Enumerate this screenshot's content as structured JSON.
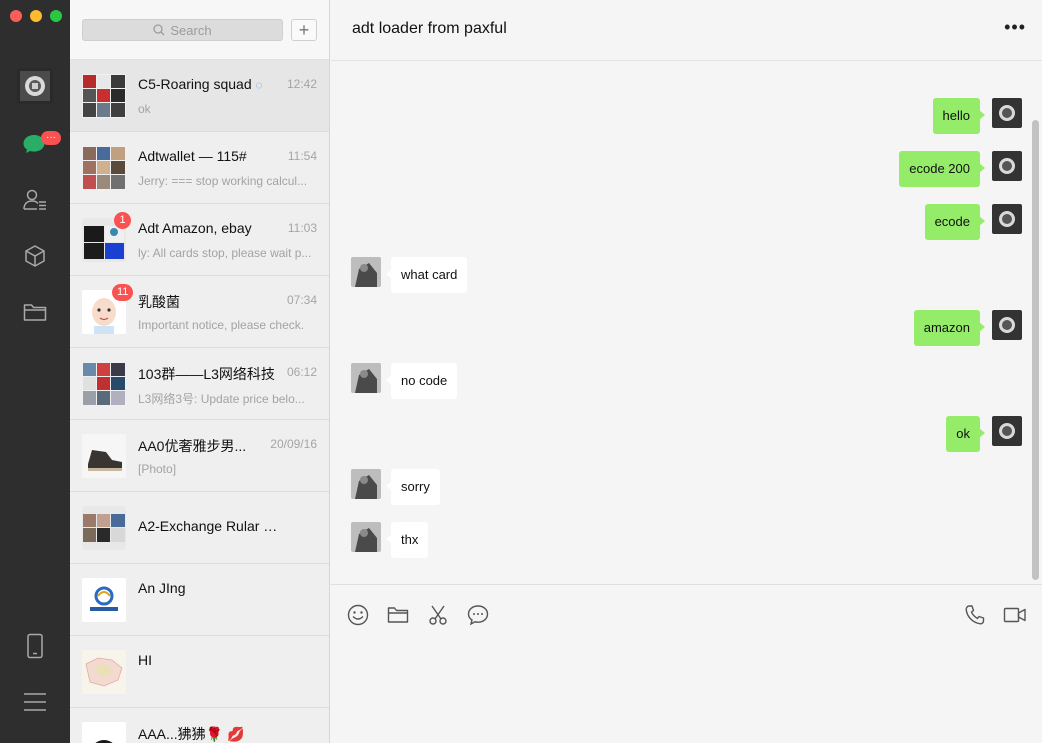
{
  "nav": {
    "chats_badge": "···",
    "icons": [
      "avatar",
      "chat-icon",
      "contacts-icon",
      "cube-icon",
      "folder-icon",
      "phone-icon",
      "menu-icon"
    ]
  },
  "search": {
    "placeholder": "Search",
    "add_label": "+"
  },
  "conversations": [
    {
      "name": "C5-Roaring squad",
      "time": "12:42",
      "preview": "ok",
      "badge": ""
    },
    {
      "name": "Adtwallet — 115#",
      "time": "11:54",
      "preview": "Jerry: === stop working calcul...",
      "badge": ""
    },
    {
      "name": "Adt Amazon, ebay",
      "time": "11:03",
      "preview": "ly: All cards stop, please wait p...",
      "badge": "1"
    },
    {
      "name": "乳酸菌",
      "time": "07:34",
      "preview": "Important notice, please check.",
      "badge": "11"
    },
    {
      "name": "103群——L3网络科技",
      "time": "06:12",
      "preview": "L3网络3号: Update price belo...",
      "badge": ""
    },
    {
      "name": "AA0优奢雅步男...",
      "time": "20/09/16",
      "preview": "[Photo]",
      "badge": ""
    },
    {
      "name": "A2-Exchange Rular ——...",
      "time": "",
      "preview": "",
      "badge": ""
    },
    {
      "name": "An JIng",
      "time": "",
      "preview": "",
      "badge": ""
    },
    {
      "name": "HI",
      "time": "",
      "preview": "",
      "badge": ""
    },
    {
      "name": "AAA...狒狒🌹 💋",
      "time": "",
      "preview": "",
      "badge": ""
    }
  ],
  "chat": {
    "title": "adt loader from paxful",
    "more_label": "•••",
    "messages": [
      {
        "dir": "out",
        "text": "hello"
      },
      {
        "dir": "out",
        "text": "ecode 200"
      },
      {
        "dir": "out",
        "text": "ecode"
      },
      {
        "dir": "in",
        "text": "what card"
      },
      {
        "dir": "out",
        "text": "amazon"
      },
      {
        "dir": "in",
        "text": "no code"
      },
      {
        "dir": "out",
        "text": "ok"
      },
      {
        "dir": "in",
        "text": "sorry"
      },
      {
        "dir": "in",
        "text": "thx"
      }
    ]
  },
  "composer": {
    "tools": [
      "emoji-icon",
      "folder-icon",
      "scissors-icon",
      "chat-bubble-icon",
      "phone-icon",
      "video-icon"
    ]
  },
  "colors": {
    "accent": "#95ec69",
    "badge": "#fa5151",
    "rail": "#2e2e2f",
    "green_chat": "#2aae67"
  }
}
